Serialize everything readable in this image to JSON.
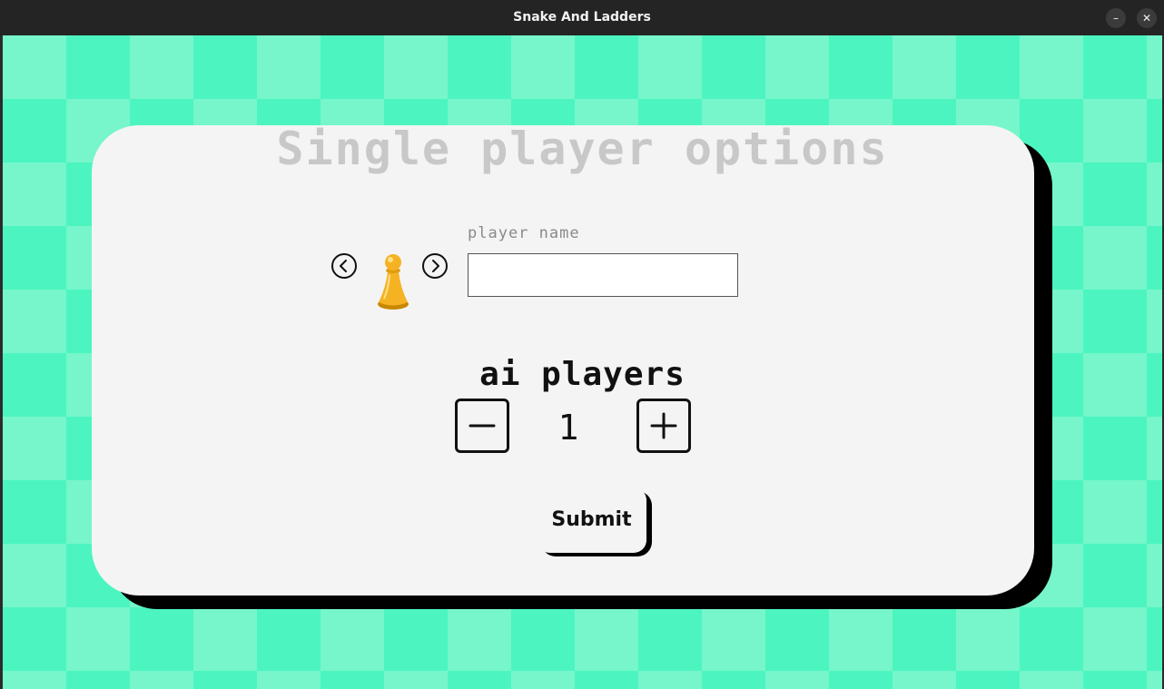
{
  "window": {
    "title": "Snake And Ladders",
    "minimize_symbol": "–",
    "close_symbol": "✕"
  },
  "panel": {
    "title": "Single player options",
    "player_name_label": "player name",
    "player_name_value": "",
    "player_name_placeholder": "",
    "ai_players_label": "ai players",
    "ai_players_count": "1",
    "submit_label": "Submit"
  },
  "icons": {
    "prev": "chevron-left-icon",
    "next": "chevron-right-icon",
    "pawn": "pawn-icon",
    "minus": "minus-icon",
    "plus": "plus-icon"
  },
  "colors": {
    "background_light": "#76f6ca",
    "background_dark": "#4cf5c0",
    "panel": "#f4f4f4",
    "title_text": "#c8c8c8",
    "pawn": "#f5b324"
  }
}
